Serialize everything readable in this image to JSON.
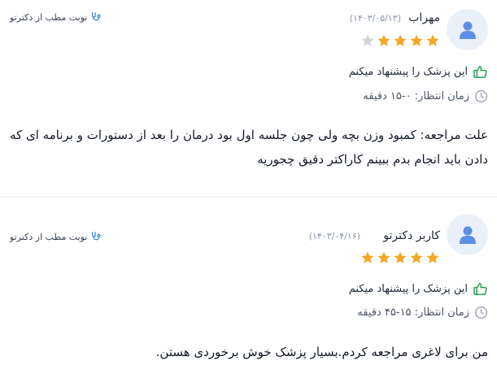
{
  "colors": {
    "star": "#f5a623",
    "star_empty": "#d1d5db",
    "accent": "#2f80ed",
    "recommend": "#22a355"
  },
  "reviews": [
    {
      "name": "مهراب",
      "date": "(۱۴۰۳/۰۵/۱۳)",
      "rating": 4,
      "rating_max": 5,
      "booking_label": "نوبت مطب از دکترتو",
      "recommend_text": "این پزشک را پیشنهاد میکنم",
      "wait_text": "زمان انتظار: ۰-۱۵ دقیقه",
      "comment": "علت مراجعه: کمبود وزن بچه ولی چون جلسه اول بود درمان را بعد از دستورات و برنامه ای که دادن باید انجام بدم ببینم کاراکتر دقیق چجوریه"
    },
    {
      "name": "کاربر دکترتو",
      "date": "(۱۴۰۳/۰۴/۱۶)",
      "rating": 5,
      "rating_max": 5,
      "booking_label": "نوبت مطب از دکترتو",
      "recommend_text": "این پزشک را پیشنهاد میکنم",
      "wait_text": "زمان انتظار: ۱۵-۴۵ دقیقه",
      "comment": "من برای لاغری مراجعه کردم.بسیار پزشک خوش برخوردی هستن."
    }
  ]
}
